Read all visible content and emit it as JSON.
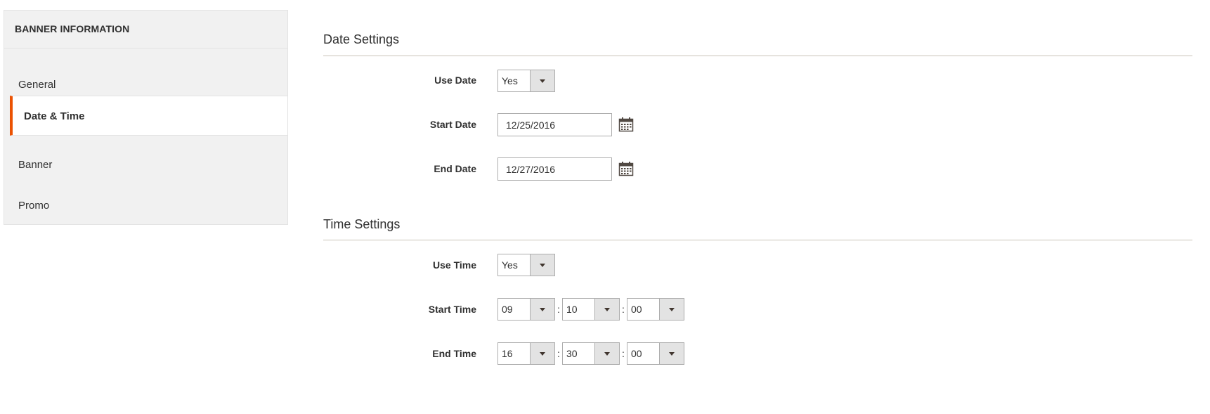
{
  "sidebar": {
    "title": "BANNER INFORMATION",
    "items": [
      {
        "label": "General"
      },
      {
        "label": "Date & Time"
      },
      {
        "label": "Banner"
      },
      {
        "label": "Promo"
      }
    ]
  },
  "date_settings": {
    "title": "Date Settings",
    "use_date": {
      "label": "Use Date",
      "value": "Yes"
    },
    "start_date": {
      "label": "Start Date",
      "value": "12/25/2016"
    },
    "end_date": {
      "label": "End Date",
      "value": "12/27/2016"
    }
  },
  "time_settings": {
    "title": "Time Settings",
    "use_time": {
      "label": "Use Time",
      "value": "Yes"
    },
    "start_time": {
      "label": "Start Time",
      "hour": "09",
      "minute": "10",
      "second": "00"
    },
    "end_time": {
      "label": "End Time",
      "hour": "16",
      "minute": "30",
      "second": "00"
    },
    "separator": ":"
  },
  "colors": {
    "accent": "#eb5202",
    "sidebar_bg": "#f1f1f1"
  },
  "icons": {
    "calendar": "calendar-icon",
    "dropdown": "chevron-down-icon"
  }
}
